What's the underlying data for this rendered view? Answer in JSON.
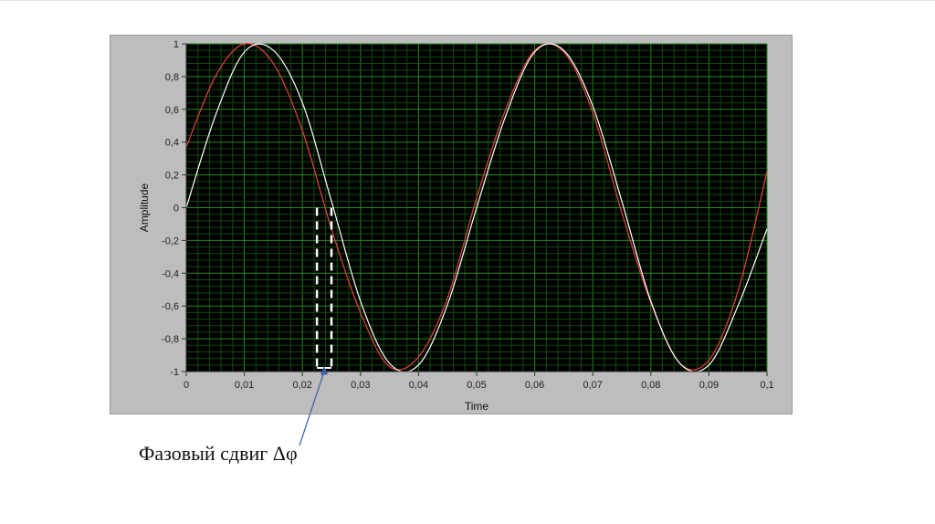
{
  "caption": {
    "text": "Фазовый сдвиг Δφ"
  },
  "colors": {
    "panel": "#bdbdbd",
    "plot_bg": "#000000",
    "grid_major": "#1f8a1f",
    "grid_minor": "#0e4a0e",
    "series_red": "#e8413c",
    "series_white": "#ffffff",
    "marker": "#ffffff",
    "arrow": "#3a5fa5"
  },
  "chart_data": {
    "type": "line",
    "xlabel": "Time",
    "ylabel": "Amplitude",
    "xlim": [
      0,
      0.1
    ],
    "ylim": [
      -1,
      1
    ],
    "grid": true,
    "x_ticks": [
      "0",
      "0,01",
      "0,02",
      "0,03",
      "0,04",
      "0,05",
      "0,06",
      "0,07",
      "0,08",
      "0,09",
      "0,1"
    ],
    "y_ticks": [
      "1",
      "0,8",
      "0,6",
      "0,4",
      "0,2",
      "0",
      "-0,2",
      "-0,4",
      "-0,6",
      "-0,8",
      "-1"
    ],
    "series": [
      {
        "color": "#e8413c",
        "x": [
          0,
          0.005,
          0.01,
          0.015,
          0.02,
          0.025,
          0.03,
          0.035,
          0.04,
          0.045,
          0.05,
          0.055,
          0.06,
          0.065,
          0.07,
          0.075,
          0.08,
          0.085,
          0.09,
          0.095,
          0.1
        ],
        "y": [
          0.37,
          0.8,
          1.0,
          0.88,
          0.47,
          -0.13,
          -0.64,
          -0.97,
          -0.91,
          -0.55,
          0.06,
          0.6,
          0.96,
          0.95,
          0.58,
          -0.03,
          -0.58,
          -0.95,
          -0.93,
          -0.51,
          0.22
        ]
      },
      {
        "color": "#ffffff",
        "x": [
          0,
          0.005,
          0.01,
          0.015,
          0.02,
          0.025,
          0.03,
          0.035,
          0.04,
          0.045,
          0.05,
          0.055,
          0.06,
          0.065,
          0.07,
          0.075,
          0.08,
          0.085,
          0.09,
          0.095,
          0.1
        ],
        "y": [
          0.0,
          0.56,
          0.95,
          0.96,
          0.64,
          0.04,
          -0.57,
          -0.95,
          -0.96,
          -0.59,
          0.0,
          0.56,
          0.95,
          0.96,
          0.62,
          0.04,
          -0.57,
          -0.95,
          -0.96,
          -0.6,
          -0.13
        ]
      }
    ],
    "annotation": {
      "text": "Фазовый сдвиг Δφ",
      "x_range": [
        0.0225,
        0.025
      ]
    }
  }
}
